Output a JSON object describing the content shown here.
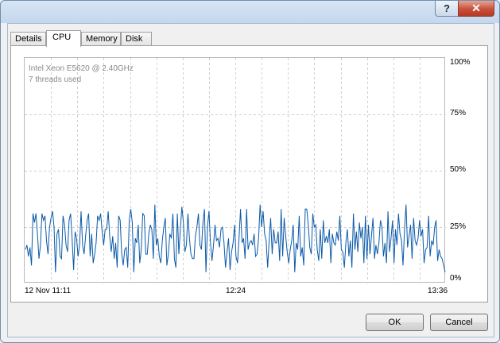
{
  "titlebar": {
    "help_label": "?",
    "close_label": "✕"
  },
  "tabs": [
    {
      "label": "Details",
      "active": false
    },
    {
      "label": "CPU",
      "active": true
    },
    {
      "label": "Memory",
      "active": false
    },
    {
      "label": "Disk",
      "active": false
    }
  ],
  "cpu": {
    "processor": "Intel Xeon  E5620 @ 2.40GHz",
    "threads": "7 threads used"
  },
  "chart_data": {
    "type": "line",
    "title": "",
    "xlabel": "",
    "ylabel": "",
    "y_tick_labels": [
      "100%",
      "75%",
      "50%",
      "25%",
      "0%"
    ],
    "x_tick_labels": [
      "12 Nov 11:11",
      "12:24",
      "13:36"
    ],
    "ylim": [
      0,
      100
    ],
    "grid": true,
    "series": [
      {
        "color": "#0b5aa8",
        "values": [
          15,
          17,
          12,
          16,
          8,
          31,
          27,
          31,
          22,
          11,
          17,
          31,
          28,
          30,
          19,
          13,
          25,
          29,
          32,
          25,
          5,
          22,
          24,
          12,
          11,
          30,
          26,
          17,
          14,
          28,
          31,
          20,
          6,
          23,
          20,
          12,
          17,
          32,
          17,
          13,
          21,
          28,
          31,
          12,
          22,
          9,
          13,
          18,
          30,
          28,
          31,
          23,
          17,
          24,
          24,
          32,
          21,
          14,
          21,
          11,
          18,
          7,
          30,
          28,
          13,
          8,
          15,
          16,
          7,
          28,
          33,
          27,
          5,
          20,
          18,
          26,
          9,
          15,
          31,
          30,
          13,
          13,
          22,
          26,
          24,
          11,
          35,
          17,
          20,
          12,
          9,
          19,
          25,
          29,
          8,
          13,
          22,
          20,
          31,
          11,
          7,
          31,
          13,
          24,
          34,
          27,
          14,
          17,
          31,
          20,
          13,
          11,
          11,
          21,
          25,
          31,
          17,
          15,
          27,
          33,
          5,
          25,
          32,
          18,
          10,
          17,
          26,
          19,
          20,
          16,
          24,
          25,
          18,
          7,
          14,
          20,
          6,
          14,
          18,
          26,
          12,
          9,
          20,
          33,
          18,
          20,
          11,
          33,
          15,
          18,
          19,
          17,
          22,
          12,
          13,
          20,
          35,
          25,
          32,
          22,
          19,
          7,
          19,
          29,
          13,
          24,
          18,
          18,
          23,
          10,
          33,
          12,
          29,
          21,
          14,
          9,
          15,
          19,
          26,
          5,
          18,
          15,
          30,
          12,
          16,
          8,
          33,
          33,
          26,
          16,
          13,
          31,
          25,
          26,
          15,
          10,
          24,
          11,
          28,
          18,
          21,
          18,
          24,
          9,
          22,
          18,
          17,
          23,
          19,
          30,
          15,
          14,
          7,
          18,
          24,
          12,
          19,
          7,
          31,
          15,
          23,
          14,
          27,
          20,
          25,
          9,
          30,
          11,
          26,
          13,
          21,
          29,
          11,
          17,
          13,
          18,
          28,
          25,
          12,
          18,
          9,
          32,
          14,
          20,
          28,
          9,
          24,
          17,
          31,
          22,
          19,
          8,
          24,
          35,
          16,
          21,
          26,
          11,
          29,
          19,
          17,
          20,
          28,
          21,
          24,
          9,
          15,
          16,
          30,
          12,
          19,
          17,
          25,
          28,
          10,
          15,
          12,
          11,
          8,
          5
        ]
      }
    ]
  },
  "buttons": {
    "ok_label": "OK",
    "cancel_label": "Cancel"
  }
}
